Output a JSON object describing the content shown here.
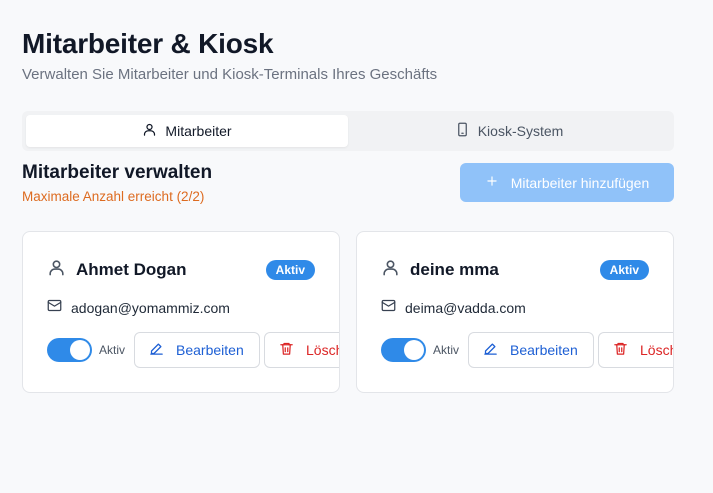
{
  "header": {
    "title": "Mitarbeiter & Kiosk",
    "subtitle": "Verwalten Sie Mitarbeiter und Kiosk-Terminals Ihres Geschäfts"
  },
  "tabs": [
    {
      "label": "Mitarbeiter",
      "icon": "user-icon",
      "active": true
    },
    {
      "label": "Kiosk-System",
      "icon": "tablet-icon",
      "active": false
    }
  ],
  "section": {
    "title": "Mitarbeiter verwalten",
    "limit_note": "Maximale Anzahl erreicht (2/2)",
    "add_button_label": "Mitarbeiter hinzufügen"
  },
  "employees": [
    {
      "name": "Ahmet Dogan",
      "email": "adogan@yomammiz.com",
      "status": "Aktiv",
      "toggle_label": "Aktiv",
      "toggle_on": true,
      "edit_label": "Bearbeiten",
      "delete_label": "Löschen"
    },
    {
      "name": "deine mma",
      "email": "deima@vadda.com",
      "status": "Aktiv",
      "toggle_label": "Aktiv",
      "toggle_on": true,
      "edit_label": "Bearbeiten",
      "delete_label": "Löschen"
    }
  ],
  "colors": {
    "accent": "#2f8ae8",
    "warning": "#dd6b20",
    "danger": "#dc2626",
    "edit": "#1d5fd4"
  }
}
